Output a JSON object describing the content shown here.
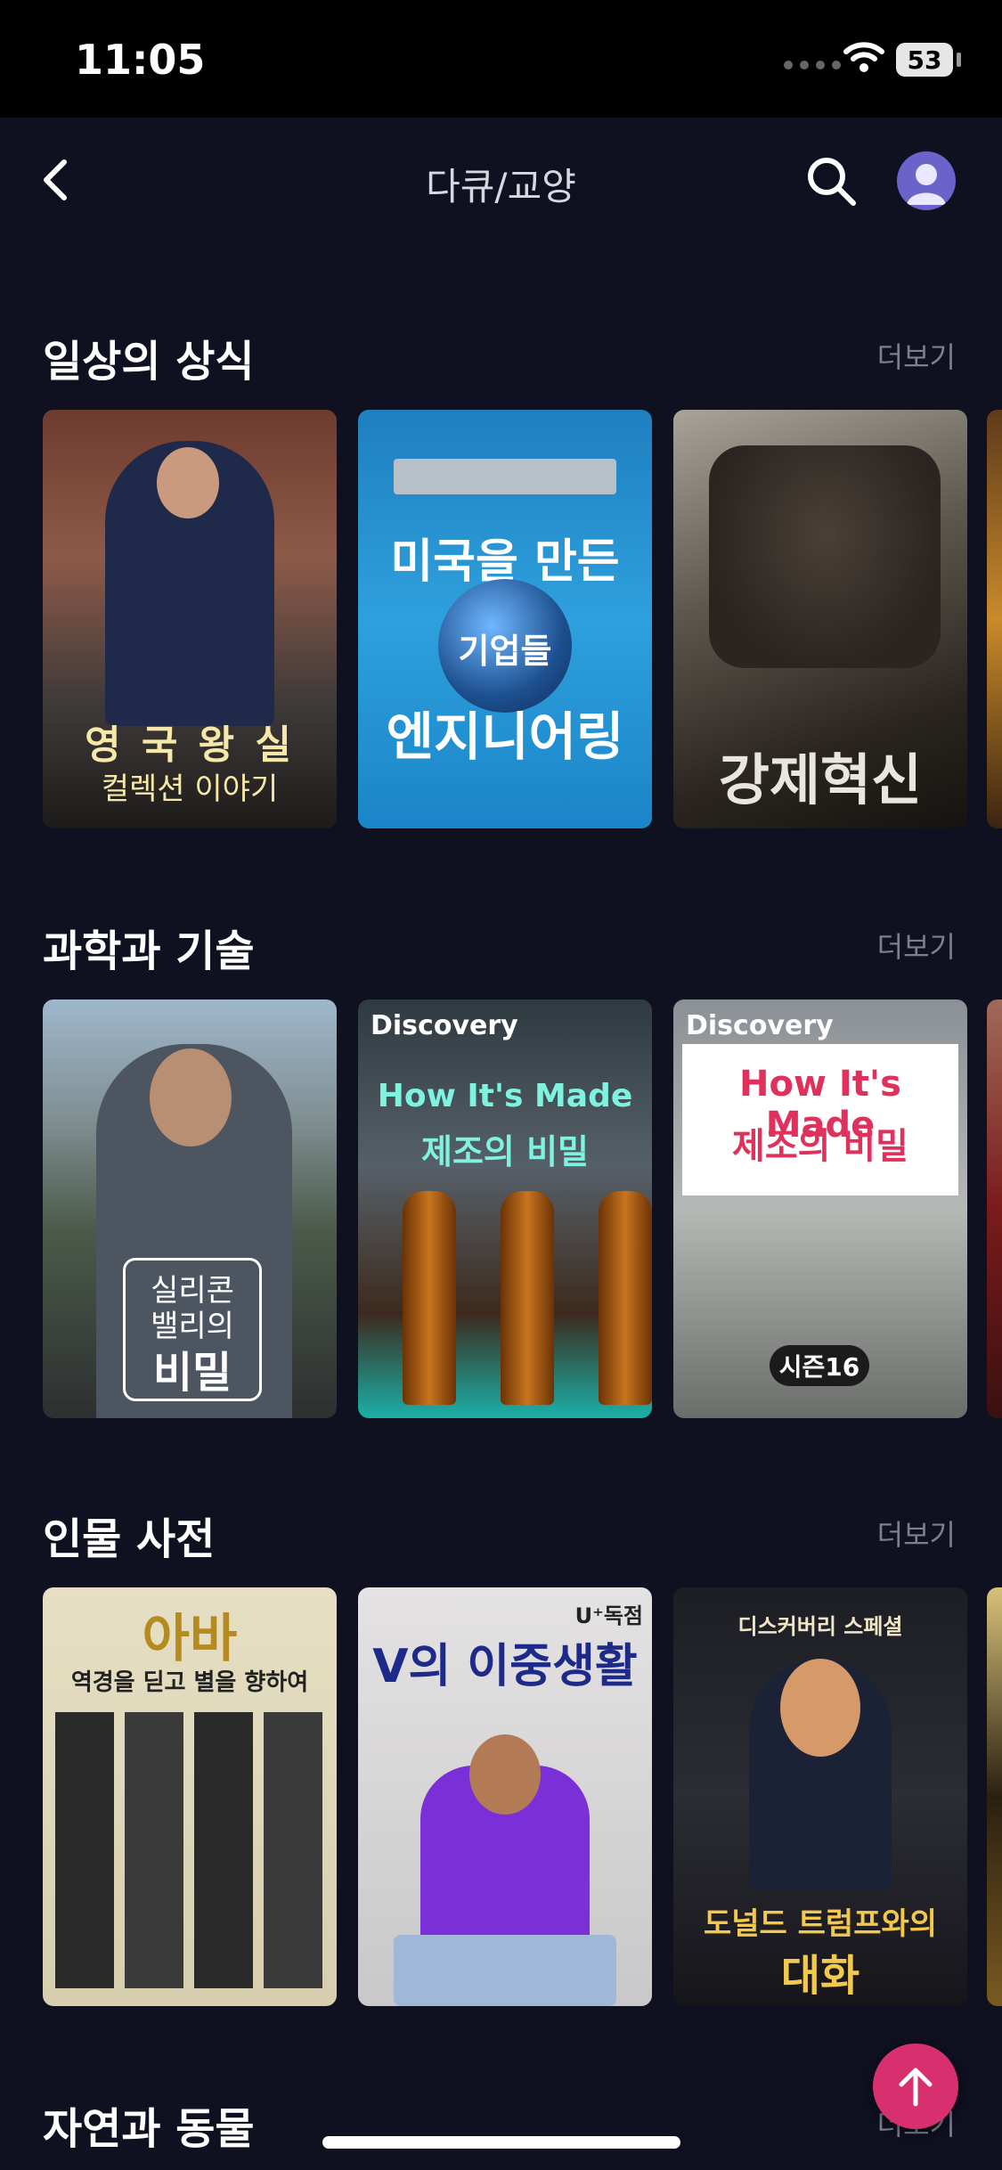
{
  "status_bar": {
    "time": "11:05",
    "battery": "53"
  },
  "header": {
    "title": "다큐/교양"
  },
  "more_label": "더보기",
  "sections": [
    {
      "title": "일상의 상식",
      "posters": [
        {
          "line1": "영 국 왕 실",
          "line2": "컬렉션 이야기"
        },
        {
          "line1": "미국을 만든",
          "line2": "기업들",
          "line3": "엔지니어링"
        },
        {
          "line1": "강제혁신"
        }
      ]
    },
    {
      "title": "과학과 기술",
      "posters": [
        {
          "line1": "실리콘",
          "line2": "밸리의",
          "line3": "비밀"
        },
        {
          "brand": "Discovery",
          "line1": "How It's Made",
          "line2": "제조의 비밀"
        },
        {
          "brand": "Discovery",
          "line1": "How It's Made",
          "line2": "제조의 비밀",
          "badge": "시즌16"
        }
      ]
    },
    {
      "title": "인물 사전",
      "posters": [
        {
          "line1": "아바",
          "line2": "역경을 딛고 별을 향하여"
        },
        {
          "corner": "U⁺독점",
          "line1": "V의 이중생활"
        },
        {
          "top": "디스커버리 스페셜",
          "line1": "도널드 트럼프와의",
          "line2": "대화"
        }
      ]
    },
    {
      "title": "자연과 동물"
    }
  ],
  "colors": {
    "background": "#0f1020",
    "accent_fab": "#d8306e",
    "avatar": "#6b63c9"
  }
}
